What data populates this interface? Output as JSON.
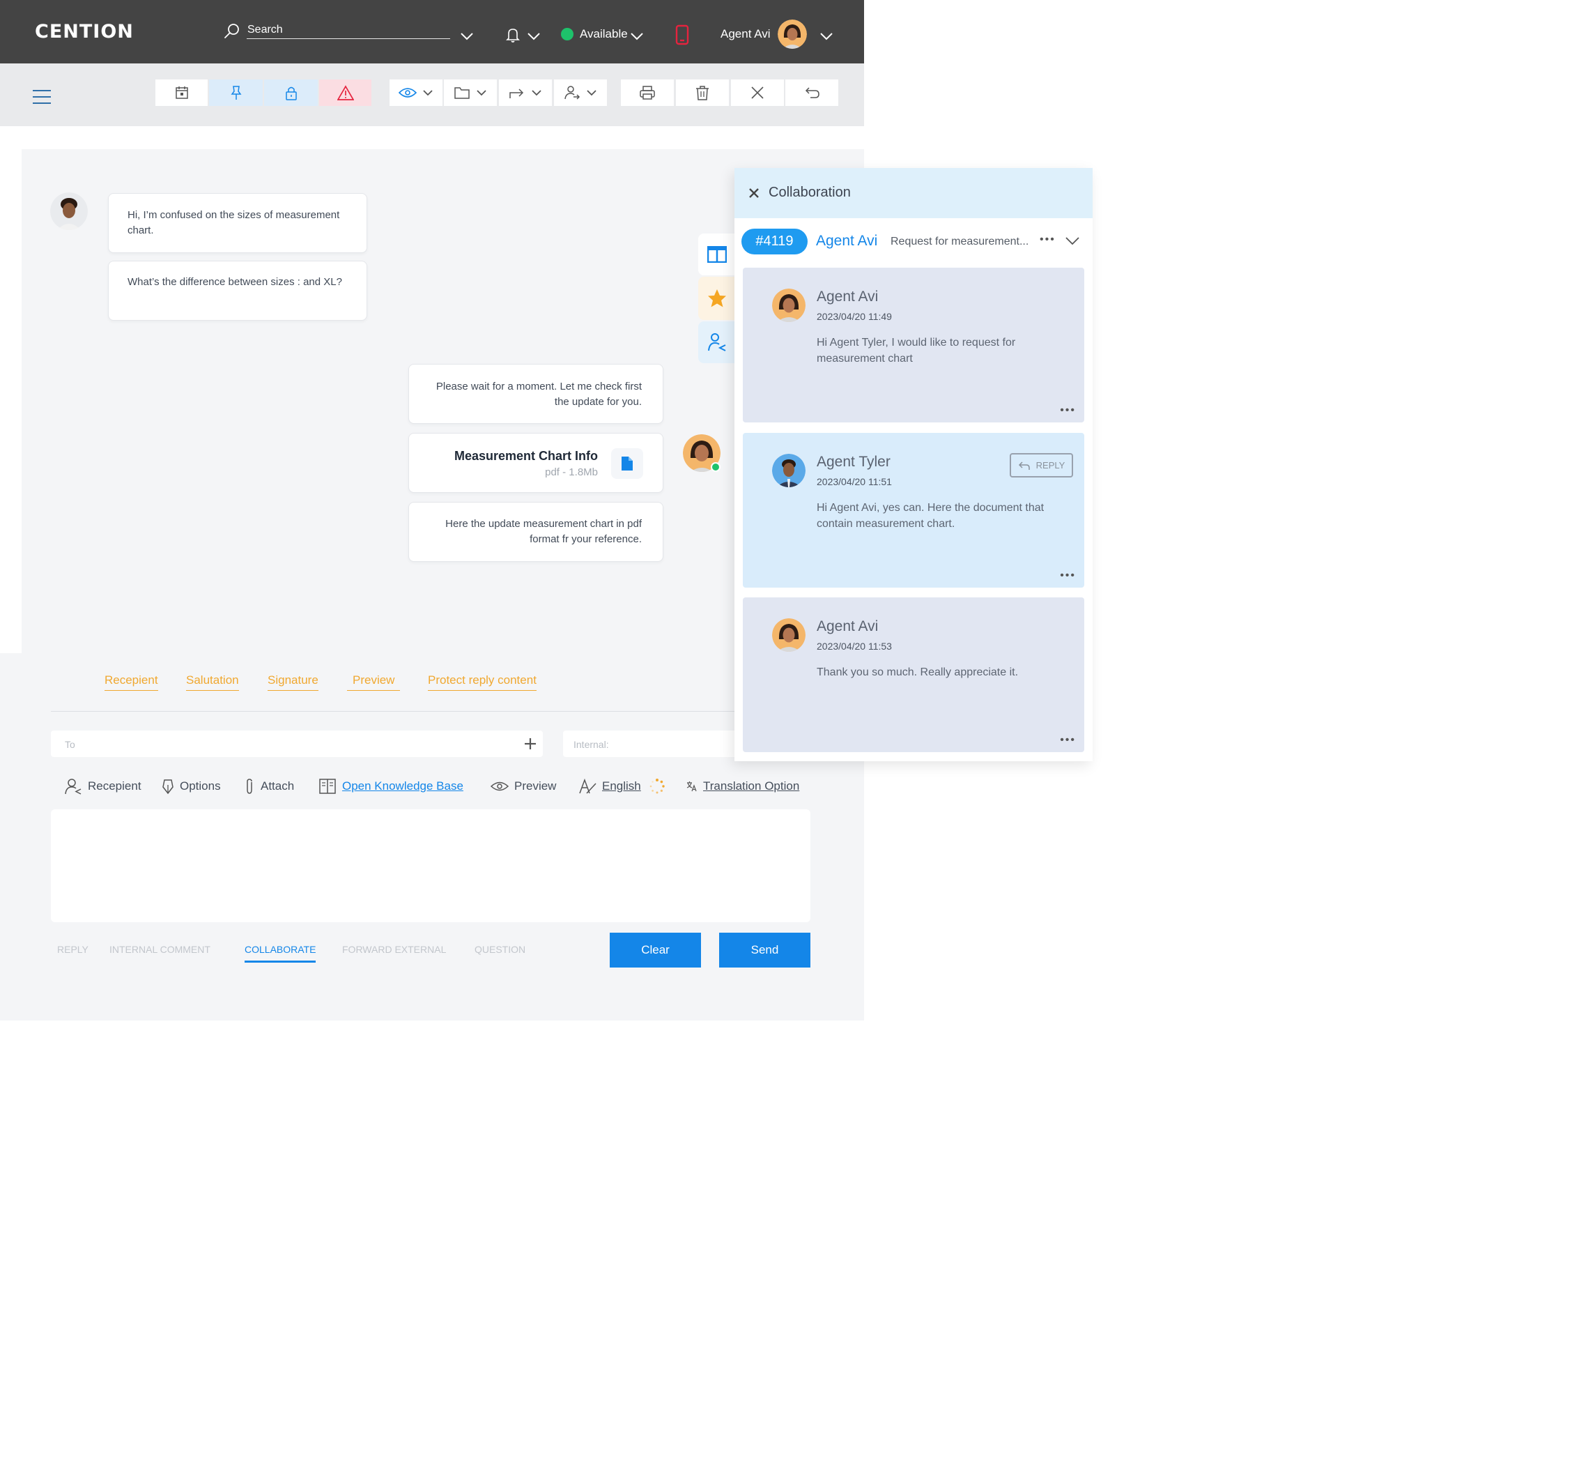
{
  "topbar": {
    "logo": "CENTION",
    "search_label": "Search",
    "status": "Available",
    "agent_name": "Agent Avi"
  },
  "colors": {
    "topbar": "#444444",
    "accent_blue": "#1486e8",
    "status_green": "#1ec26b",
    "alert_red": "#e5233e",
    "orange_link": "#f0a830"
  },
  "toolbar": {
    "icons": [
      "calendar-icon",
      "pin-icon",
      "lock-icon",
      "warning-icon",
      "eye-icon",
      "folder-icon",
      "forward-icon",
      "assign-user-icon",
      "print-icon",
      "delete-icon",
      "close-icon",
      "undo-icon"
    ]
  },
  "conversation": {
    "customer_messages": [
      "Hi, I’m confused on the sizes of measurement chart.",
      "What’s the difference between sizes : and XL?"
    ],
    "agent_messages": [
      "Please wait for a moment. Let me check first the update for you.",
      "Here the update measurement chart in pdf format fr your reference."
    ],
    "attachment": {
      "title": "Measurement Chart Info",
      "meta": "pdf - 1.8Mb"
    }
  },
  "collaboration": {
    "title": "Collaboration",
    "ticket_badge": "#4119",
    "agent": "Agent Avi",
    "subject": "Request for measurement...",
    "reply_label": "REPLY",
    "messages": [
      {
        "name": "Agent Avi",
        "time": "2023/04/20 11:49",
        "text": "Hi Agent Tyler, I would like to request for measurement chart"
      },
      {
        "name": "Agent Tyler",
        "time": "2023/04/20 11:51",
        "text": "Hi Agent Avi, yes can. Here the document that contain measurement chart."
      },
      {
        "name": "Agent Avi",
        "time": "2023/04/20 11:53",
        "text": "Thank you so much. Really appreciate it."
      }
    ]
  },
  "composer": {
    "tags": [
      "Recepient",
      "Salutation",
      "Signature",
      "Preview",
      "Protect reply content"
    ],
    "to_placeholder": "To",
    "internal_placeholder": "Internal:",
    "tools": {
      "recepient": "Recepient",
      "options": "Options",
      "attach": "Attach",
      "knowledge": "Open Knowledge Base",
      "preview": "Preview",
      "language": "English",
      "translation": "Translation Option"
    },
    "modes": [
      "REPLY",
      "INTERNAL COMMENT",
      "COLLABORATE",
      "FORWARD EXTERNAL",
      "QUESTION"
    ],
    "active_mode": "COLLABORATE",
    "clear_label": "Clear",
    "send_label": "Send"
  }
}
